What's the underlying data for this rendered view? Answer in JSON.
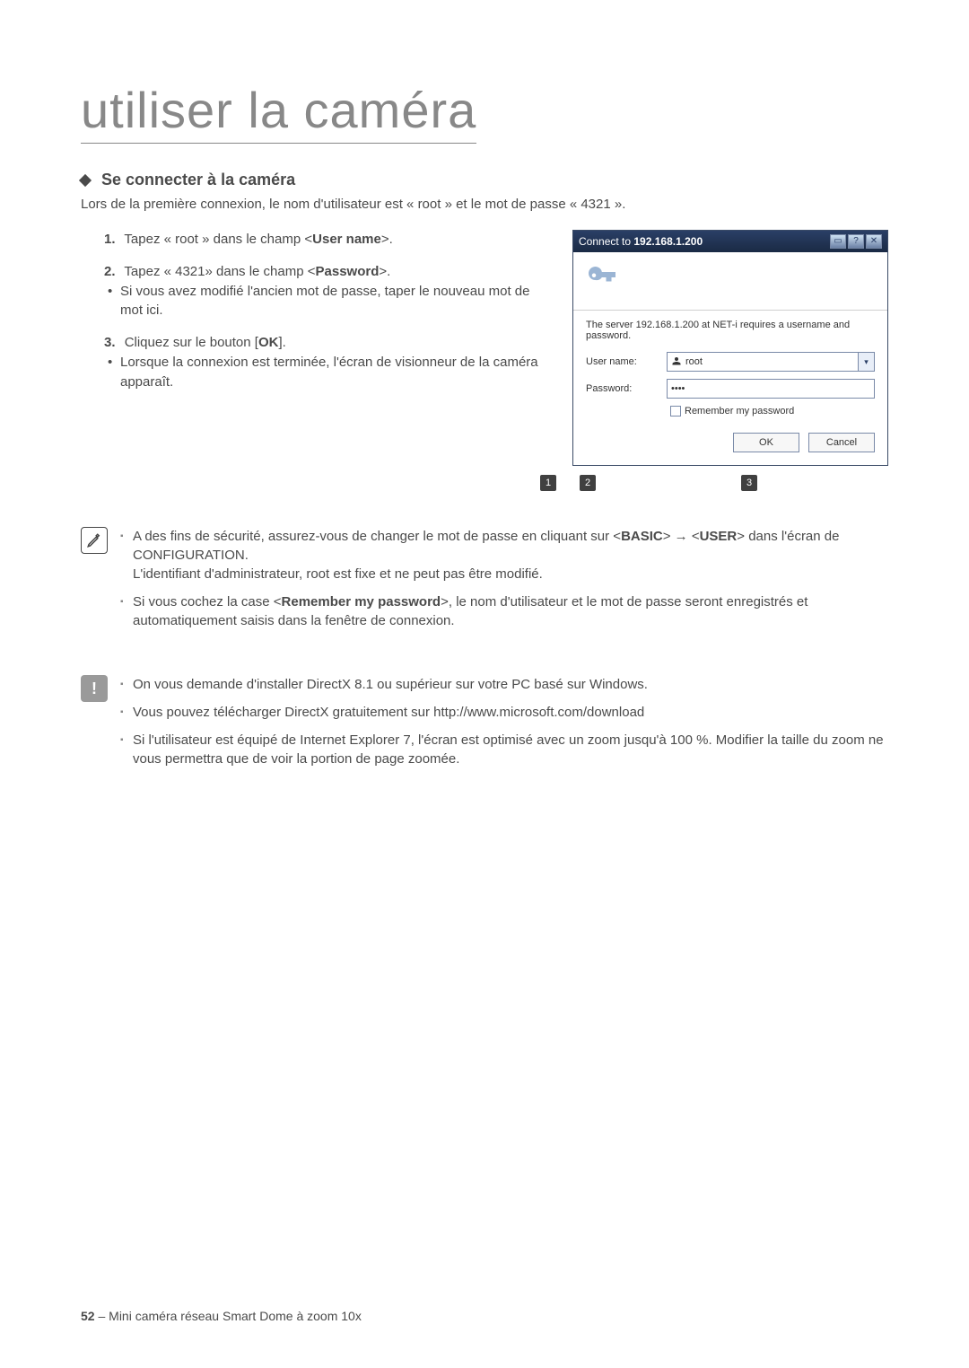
{
  "page_title": "utiliser la caméra",
  "section": {
    "heading": "Se connecter à la caméra",
    "intro": "Lors de la première connexion, le nom d'utilisateur est « root » et le mot de passe « 4321 »."
  },
  "steps": [
    {
      "num": "1.",
      "text_before": "Tapez « root » dans le champ <",
      "bold": "User name",
      "text_after": ">."
    },
    {
      "num": "2.",
      "text_before": "Tapez « 4321» dans le champ <",
      "bold": "Password",
      "text_after": ">.",
      "sub": "Si vous avez modifié l'ancien mot de passe, taper le nouveau mot de mot ici."
    },
    {
      "num": "3.",
      "text_before": "Cliquez sur le bouton [",
      "bold": "OK",
      "text_after": "].",
      "sub": "Lorsque la connexion est terminée, l'écran de visionneur de la caméra apparaît."
    }
  ],
  "dialog": {
    "title_prefix": "Connect to ",
    "title_ip": "192.168.1.200",
    "titlebar_btn1": "▭",
    "titlebar_btn2": "?",
    "titlebar_btn3": "✕",
    "message": "The server 192.168.1.200 at NET-i requires a username and password.",
    "label_user": "User name:",
    "value_user": "root",
    "label_pass": "Password:",
    "value_pass": "••••",
    "remember": "Remember my password",
    "btn_ok": "OK",
    "btn_cancel": "Cancel"
  },
  "callouts": [
    "1",
    "2",
    "3"
  ],
  "note1": {
    "line1_a": "A des fins de sécurité, assurez-vous de changer le mot de passe en cliquant sur <",
    "line1_b1": "BASIC",
    "line1_arrow": "> → <",
    "line1_b2": "USER",
    "line1_c": "> dans l'écran de CONFIGURATION.",
    "line2": "L'identifiant d'administrateur, root est fixe et ne peut pas être modifié.",
    "line3_a": "Si vous cochez la case <",
    "line3_b": "Remember my password",
    "line3_c": ">, le nom d'utilisateur et le mot de passe seront enregistrés et automatiquement saisis dans la fenêtre de connexion."
  },
  "note2": {
    "line1": "On vous demande d'installer DirectX 8.1 ou supérieur sur votre PC basé sur Windows.",
    "line2": "Vous pouvez télécharger DirectX gratuitement sur http://www.microsoft.com/download",
    "line3": "Si l'utilisateur est équipé de Internet Explorer 7, l'écran est optimisé avec un zoom jusqu'à 100 %. Modifier la taille du zoom ne vous permettra que de voir la portion de page zoomée."
  },
  "footer": {
    "page": "52",
    "sep": " – ",
    "title": "Mini caméra réseau Smart Dome à zoom 10x"
  }
}
